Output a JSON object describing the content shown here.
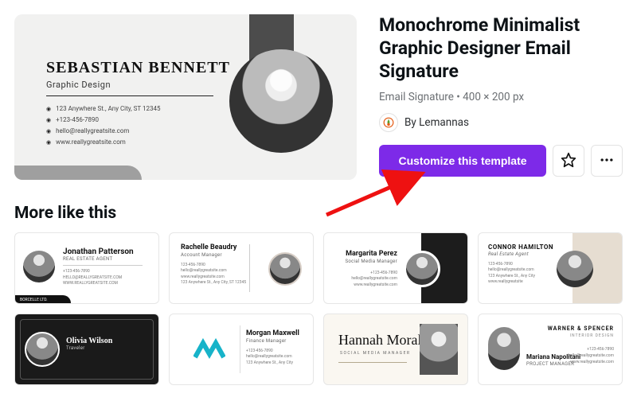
{
  "hero": {
    "name": "SEBASTIAN BENNETT",
    "role": "Graphic Design",
    "lines": {
      "address": "123 Anywhere St., Any City, ST 12345",
      "phone": "+123-456-7890",
      "email": "hello@reallygreatsite.com",
      "web": "www.reallygreatsite.com"
    }
  },
  "template": {
    "title": "Monochrome Minimalist Graphic Designer Email Signature",
    "subtitle": "Email Signature • 400 × 200 px",
    "byline_prefix": "By ",
    "author": "Lemannas",
    "cta": "Customize this template"
  },
  "more_title": "More like this",
  "cards": {
    "c1": {
      "name": "Jonathan Patterson",
      "role": "REAL ESTATE AGENT",
      "l1": "+123-456-7890",
      "l2": "HELLO@REALLYGREATSITE.COM",
      "l3": "WWW.REALLYGREATSITE.COM",
      "foot": "BORCELLE LTD."
    },
    "c2": {
      "name": "Rachelle Beaudry",
      "role": "Account Manager",
      "l1": "123-456-7890",
      "l2": "hello@reallygreatsite.com",
      "l3": "www.reallygreatsite.com",
      "l4": "123 Anywhere St., Any City, ST 12345"
    },
    "c3": {
      "name": "Margarita Perez",
      "role": "Social Media Manager",
      "l1": "+123-456-7890",
      "l2": "hello@reallygreatsite.com",
      "l3": "www.reallygreatsite.com"
    },
    "c4": {
      "name": "CONNOR HAMILTON",
      "role": "Real Estate Agent",
      "l1": "123-456-7890",
      "l2": "hello@reallygreatsite.com",
      "l3": "123 Anywhere St., Any City",
      "l4": "www.reallygreatsite"
    },
    "c5": {
      "name": "Olivia Wilson",
      "role": "Traveler"
    },
    "c6": {
      "name": "Morgan Maxwell",
      "role": "Finance Manager",
      "l1": "+123-456-7890",
      "l2": "hello@reallygreatsite.com",
      "l3": "123 Anywhere St., Any City"
    },
    "c7": {
      "name": "Hannah Morales",
      "role": "SOCIAL MEDIA MANAGER"
    },
    "c8": {
      "brand": "WARNER & SPENCER",
      "brandrole": "INTERIOR DESIGN",
      "name": "Mariana Napolitani",
      "role": "PROJECT MANAGER",
      "l1": "+123-456-7890",
      "l2": "hello@reallygreatsite.com",
      "l3": "www.reallygreatsite.com"
    }
  }
}
